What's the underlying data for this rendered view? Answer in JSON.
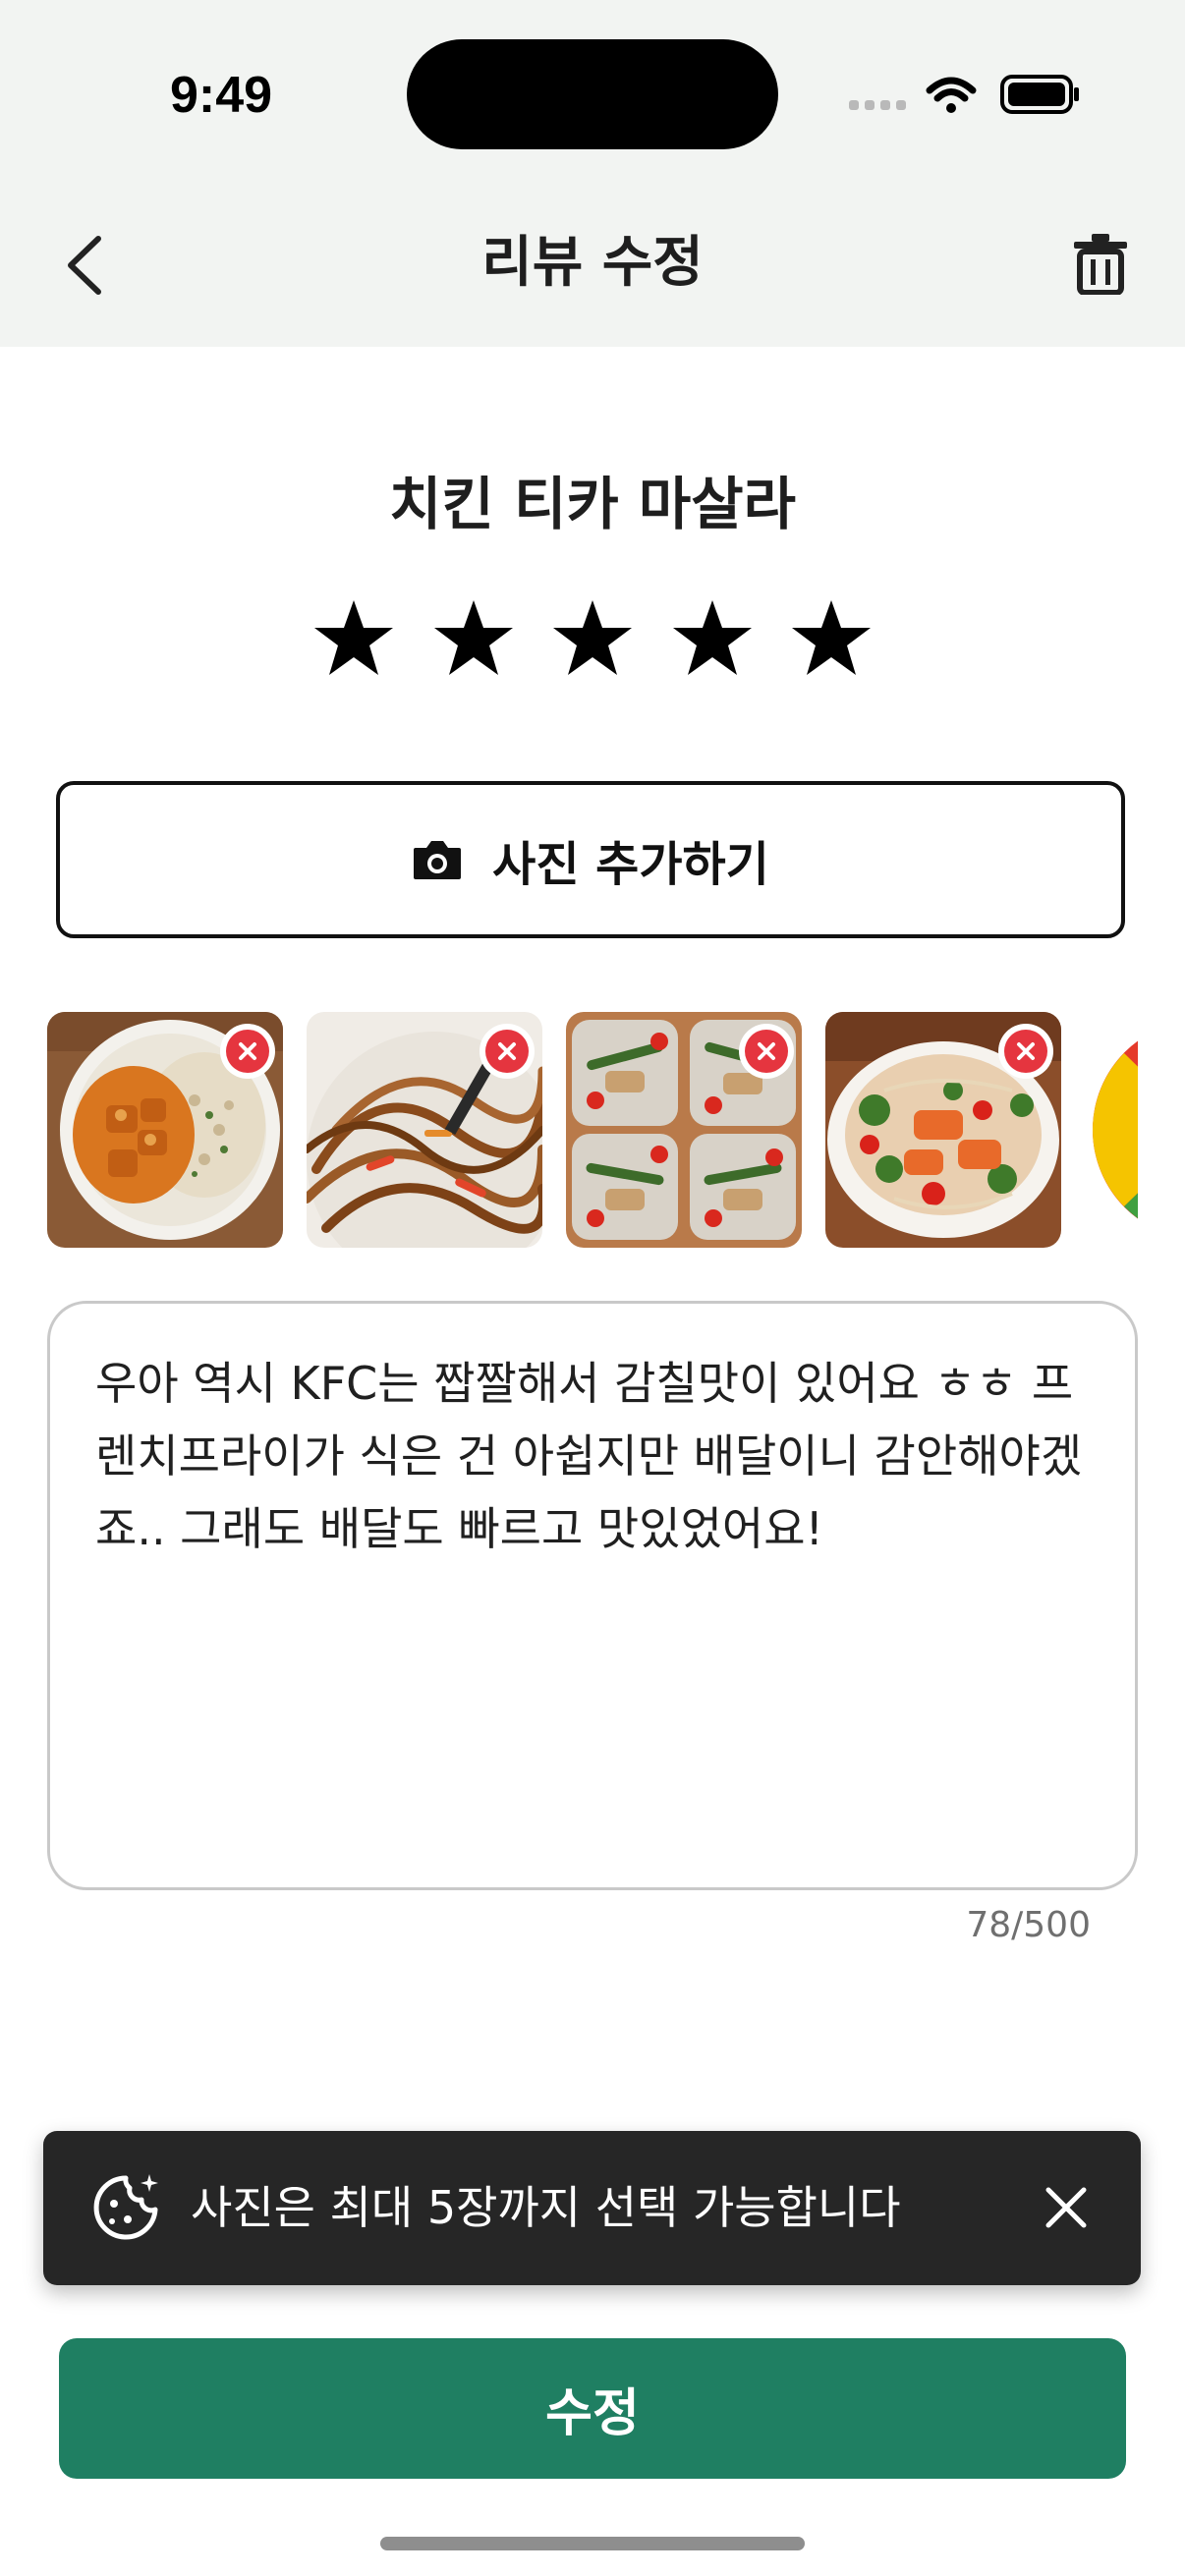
{
  "status_bar": {
    "time": "9:49"
  },
  "header": {
    "title": "리뷰 수정"
  },
  "menu": {
    "name": "치킨 티카 마살라"
  },
  "rating": {
    "value": 5,
    "max": 5
  },
  "add_photo": {
    "label": "사진 추가하기"
  },
  "photos": [
    {
      "alt": "chicken-tikka-masala-with-rice"
    },
    {
      "alt": "stir-fried-noodles"
    },
    {
      "alt": "meal-prep-chicken-green-beans"
    },
    {
      "alt": "chicken-salad-bowl"
    },
    {
      "alt": "partial-fifth-photo"
    }
  ],
  "review": {
    "text": "우아 역시 KFC는 짭짤해서 감칠맛이 있어요 ㅎㅎ 프렌치프라이가 식은 건 아쉽지만 배달이니 감안해야겠죠.. 그래도 배달도 빠르고 맛있었어요!",
    "char_count": "78/500"
  },
  "toast": {
    "message": "사진은 최대 5장까지 선택 가능합니다"
  },
  "submit": {
    "label": "수정"
  },
  "colors": {
    "primary": "#1f7f62",
    "remove_badge": "#e5353f",
    "toast_bg": "#262626",
    "header_bg": "#f2f4f2"
  }
}
